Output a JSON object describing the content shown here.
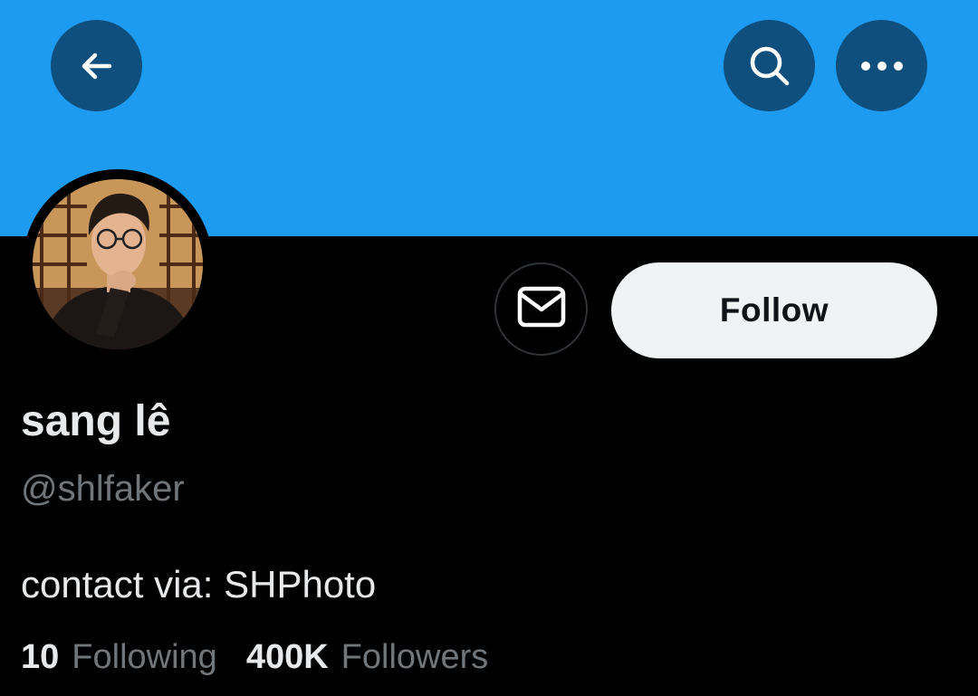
{
  "header": {
    "back_icon": "arrow-left-icon",
    "search_icon": "search-icon",
    "more_icon": "more-horizontal-icon",
    "banner_color": "#1D9BF0",
    "button_color": "#0F4F7D"
  },
  "profile": {
    "display_name": "sang lê",
    "handle": "@shlfaker",
    "bio": "contact via: SHPhoto",
    "avatar_icon": "profile-photo"
  },
  "actions": {
    "message_icon": "envelope-icon",
    "follow_label": "Follow"
  },
  "stats": {
    "following_count": "10",
    "following_label": "Following",
    "followers_count": "400K",
    "followers_label": "Followers"
  }
}
